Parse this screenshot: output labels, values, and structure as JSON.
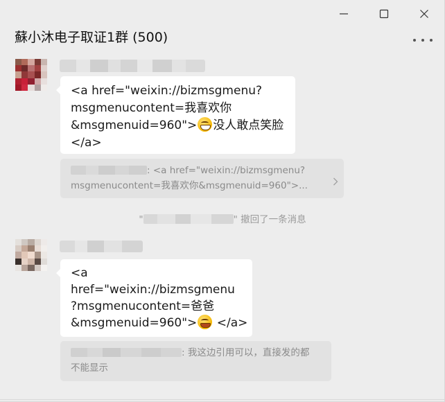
{
  "window": {
    "controls": {
      "minimize": "minimize-icon",
      "maximize": "maximize-icon",
      "close": "close-icon"
    }
  },
  "header": {
    "title": "蘇小沐电子取证1群 (500)",
    "more_icon": "more-dots-icon"
  },
  "messages": [
    {
      "sender_name": "",
      "sender_hidden": true,
      "bubble_lines": [
        "<a href=\"weixin://bizmsgmenu?",
        "msgmenucontent=我喜欢你",
        "&msgmenuid=960\">",
        "没人敢点笑脸",
        "</a>"
      ],
      "emoji": "grinning-face-emoji",
      "quote": {
        "sender_hidden": true,
        "separator": ": ",
        "line1": "<a href=\"weixin://bizmsgmenu?",
        "line2": "msgmenucontent=我喜欢你&msgmenuid=960\">..."
      }
    },
    {
      "sender_name": "",
      "sender_hidden": true,
      "bubble_lines": [
        "<a",
        "href=\"weixin://bizmsgmenu",
        "?msgmenucontent=爸爸",
        "&msgmenuid=960\">",
        " </a>"
      ],
      "emoji": "grinning-face-emoji",
      "quote": {
        "sender_hidden": true,
        "separator": ": ",
        "line1": "我这边引用可以，直接发的都",
        "line2": "不能显示"
      }
    }
  ],
  "system_notice": {
    "prefix": "\"",
    "suffix": "\" 撤回了一条消息"
  },
  "colors": {
    "background": "#ededed",
    "bubble": "#ffffff",
    "quote": "#e2e2e2",
    "muted_text": "#8a8a8a"
  }
}
